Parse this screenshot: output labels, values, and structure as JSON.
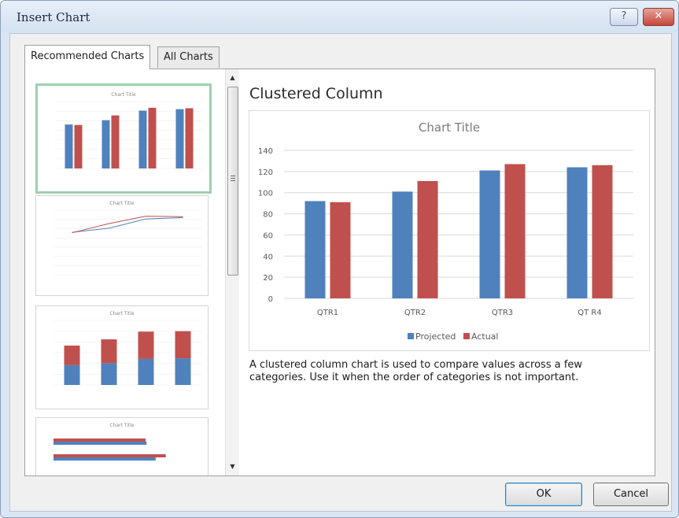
{
  "window": {
    "title": "Insert Chart",
    "help_label": "?",
    "close_label": "✕"
  },
  "tabs": [
    {
      "label": "Recommended Charts",
      "active": true
    },
    {
      "label": "All Charts",
      "active": false
    }
  ],
  "thumbnails": [
    {
      "kind": "clustered-column",
      "title": "Chart Title",
      "selected": true
    },
    {
      "kind": "line",
      "title": "Chart Title",
      "selected": false
    },
    {
      "kind": "stacked-column",
      "title": "Chart Title",
      "selected": false
    },
    {
      "kind": "clustered-bar",
      "title": "Chart Title",
      "selected": false
    }
  ],
  "preview": {
    "heading": "Clustered Column",
    "description": "A clustered column chart is used to compare values across a few categories. Use it when the order of categories is not important."
  },
  "chart_data": {
    "type": "bar",
    "title": "Chart Title",
    "categories": [
      "QTR1",
      "QTR2",
      "QTR3",
      "QTR4"
    ],
    "category_labels_as_shown": [
      "QTR1",
      "QTR2",
      "QTR3",
      "QT R4"
    ],
    "series": [
      {
        "name": "Projected",
        "values": [
          92,
          101,
          121,
          124
        ],
        "color": "#4f81bd"
      },
      {
        "name": "Actual",
        "values": [
          91,
          111,
          127,
          126
        ],
        "color": "#c0504d"
      }
    ],
    "y_ticks": [
      "0",
      "20",
      "40",
      "60",
      "80",
      "100",
      "120",
      "140"
    ],
    "ylim": [
      0,
      140
    ],
    "grid": true,
    "legend": "bottom"
  },
  "buttons": {
    "ok": "OK",
    "cancel": "Cancel"
  },
  "icons": {
    "scroll_up": "scroll-up-arrow-icon",
    "scroll_down": "scroll-down-arrow-icon",
    "grip": "scroll-grip-icon"
  }
}
